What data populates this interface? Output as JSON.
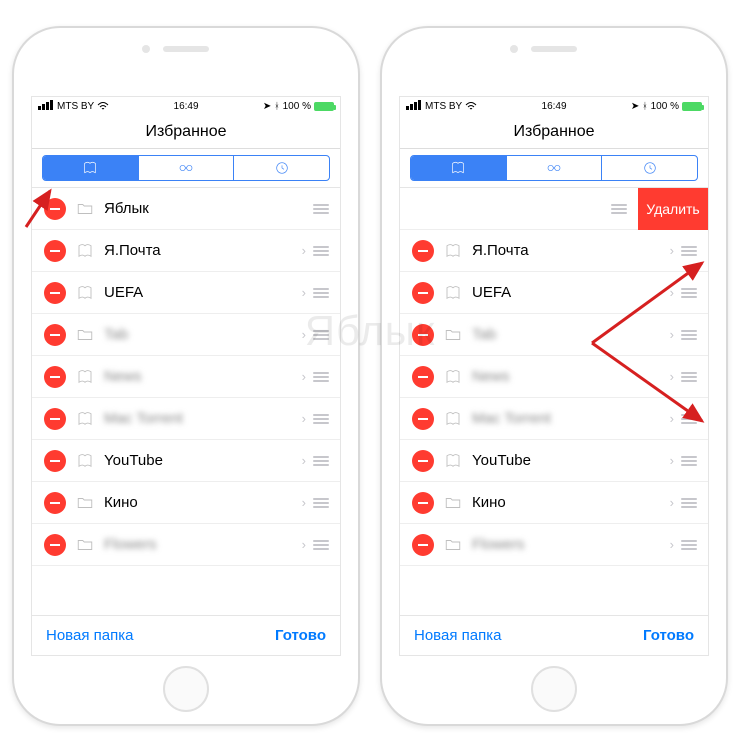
{
  "watermark": "Яблык",
  "status": {
    "carrier": "MTS BY",
    "wifi": true,
    "time": "16:49",
    "battery_pct": "100 %"
  },
  "navbar": {
    "title": "Избранное"
  },
  "tabs": {
    "bookmarks_icon": "bookmarks",
    "reading_icon": "glasses",
    "history_icon": "clock",
    "active": 0
  },
  "toolbar": {
    "new_folder": "Новая папка",
    "done": "Готово"
  },
  "delete_label": "Удалить",
  "rows": [
    {
      "type": "folder",
      "title": "Яблык",
      "blurred": false,
      "chevron": false
    },
    {
      "type": "bookmark",
      "title": "Я.Почта",
      "blurred": false,
      "chevron": true
    },
    {
      "type": "bookmark",
      "title": "UEFA",
      "blurred": false,
      "chevron": true
    },
    {
      "type": "folder",
      "title": "Tab",
      "blurred": true,
      "chevron": true
    },
    {
      "type": "bookmark",
      "title": "News",
      "blurred": true,
      "chevron": true
    },
    {
      "type": "bookmark",
      "title": "Mac Torrent",
      "blurred": true,
      "chevron": true
    },
    {
      "type": "bookmark",
      "title": "YouTube",
      "blurred": false,
      "chevron": true
    },
    {
      "type": "folder",
      "title": "Кино",
      "blurred": false,
      "chevron": true
    },
    {
      "type": "folder",
      "title": "Flowers",
      "blurred": true,
      "chevron": true
    }
  ],
  "right_phone_shift_index": 0
}
